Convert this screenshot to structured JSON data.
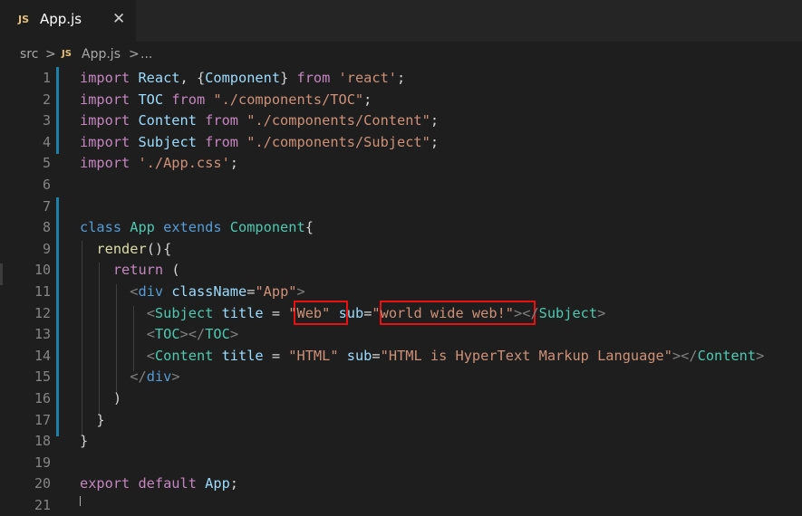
{
  "tab": {
    "icon": "JS",
    "name": "App.js",
    "close": "✕"
  },
  "breadcrumb": {
    "folder": "src",
    "sep": ">",
    "icon": "JS",
    "file": "App.js",
    "more": "..."
  },
  "lines": [
    {
      "n": "1",
      "t": [
        [
          "k",
          "import "
        ],
        [
          "v",
          "React"
        ],
        [
          "p",
          ", {"
        ],
        [
          "v",
          "Component"
        ],
        [
          "p",
          "} "
        ],
        [
          "k",
          "from "
        ],
        [
          "s",
          "'react'"
        ],
        [
          "p",
          ";"
        ]
      ]
    },
    {
      "n": "2",
      "t": [
        [
          "k",
          "import "
        ],
        [
          "v",
          "TOC "
        ],
        [
          "k",
          "from "
        ],
        [
          "s",
          "\"./components/TOC\""
        ],
        [
          "p",
          ";"
        ]
      ]
    },
    {
      "n": "3",
      "t": [
        [
          "k",
          "import "
        ],
        [
          "v",
          "Content "
        ],
        [
          "k",
          "from "
        ],
        [
          "s",
          "\"./components/Content\""
        ],
        [
          "p",
          ";"
        ]
      ]
    },
    {
      "n": "4",
      "t": [
        [
          "k",
          "import "
        ],
        [
          "v",
          "Subject "
        ],
        [
          "k",
          "from "
        ],
        [
          "s",
          "\"./components/Subject\""
        ],
        [
          "p",
          ";"
        ]
      ]
    },
    {
      "n": "5",
      "t": [
        [
          "k",
          "import "
        ],
        [
          "s",
          "'./App.css'"
        ],
        [
          "p",
          ";"
        ]
      ]
    },
    {
      "n": "6",
      "t": []
    },
    {
      "n": "7",
      "t": []
    },
    {
      "n": "8",
      "t": [
        [
          "kb",
          "class "
        ],
        [
          "c",
          "App "
        ],
        [
          "kb",
          "extends "
        ],
        [
          "c",
          "Component"
        ],
        [
          "p",
          "{"
        ]
      ]
    },
    {
      "n": "9",
      "t": [
        [
          "p",
          "  "
        ],
        [
          "f",
          "render"
        ],
        [
          "p",
          "(){"
        ]
      ]
    },
    {
      "n": "10",
      "t": [
        [
          "p",
          "    "
        ],
        [
          "k",
          "return "
        ],
        [
          "p",
          "("
        ]
      ]
    },
    {
      "n": "11",
      "t": [
        [
          "p",
          "      "
        ],
        [
          "tg",
          "<"
        ],
        [
          "kb",
          "div "
        ],
        [
          "v",
          "className"
        ],
        [
          "p",
          "="
        ],
        [
          "s",
          "\"App\""
        ],
        [
          "tg",
          ">"
        ]
      ]
    },
    {
      "n": "12",
      "t": [
        [
          "p",
          "        "
        ],
        [
          "tg",
          "<"
        ],
        [
          "c",
          "Subject "
        ],
        [
          "v",
          "title "
        ],
        [
          "p",
          "= "
        ],
        [
          "s",
          "\"Web\""
        ],
        [
          "p",
          " "
        ],
        [
          "v",
          "sub"
        ],
        [
          "p",
          "="
        ],
        [
          "s",
          "\"world wide web!\""
        ],
        [
          "tg",
          "></"
        ],
        [
          "c",
          "Subject"
        ],
        [
          "tg",
          ">"
        ]
      ]
    },
    {
      "n": "13",
      "t": [
        [
          "p",
          "        "
        ],
        [
          "tg",
          "<"
        ],
        [
          "c",
          "TOC"
        ],
        [
          "tg",
          "></"
        ],
        [
          "c",
          "TOC"
        ],
        [
          "tg",
          ">"
        ]
      ]
    },
    {
      "n": "14",
      "t": [
        [
          "p",
          "        "
        ],
        [
          "tg",
          "<"
        ],
        [
          "c",
          "Content "
        ],
        [
          "v",
          "title "
        ],
        [
          "p",
          "= "
        ],
        [
          "s",
          "\"HTML\""
        ],
        [
          "p",
          " "
        ],
        [
          "v",
          "sub"
        ],
        [
          "p",
          "="
        ],
        [
          "s",
          "\"HTML is HyperText Markup Language\""
        ],
        [
          "tg",
          "></"
        ],
        [
          "c",
          "Content"
        ],
        [
          "tg",
          ">"
        ]
      ]
    },
    {
      "n": "15",
      "t": [
        [
          "p",
          "      "
        ],
        [
          "tg",
          "</"
        ],
        [
          "kb",
          "div"
        ],
        [
          "tg",
          ">"
        ]
      ]
    },
    {
      "n": "16",
      "t": [
        [
          "p",
          "    )"
        ]
      ]
    },
    {
      "n": "17",
      "t": [
        [
          "p",
          "  }"
        ]
      ]
    },
    {
      "n": "18",
      "t": [
        [
          "p",
          "}"
        ]
      ]
    },
    {
      "n": "19",
      "t": []
    },
    {
      "n": "20",
      "t": [
        [
          "k",
          "export "
        ],
        [
          "k",
          "default "
        ],
        [
          "v",
          "App"
        ],
        [
          "p",
          ";"
        ]
      ]
    },
    {
      "n": "21",
      "t": []
    }
  ],
  "colors": {
    "highlight": "#e81010",
    "git_modified": "#1b81a8"
  }
}
